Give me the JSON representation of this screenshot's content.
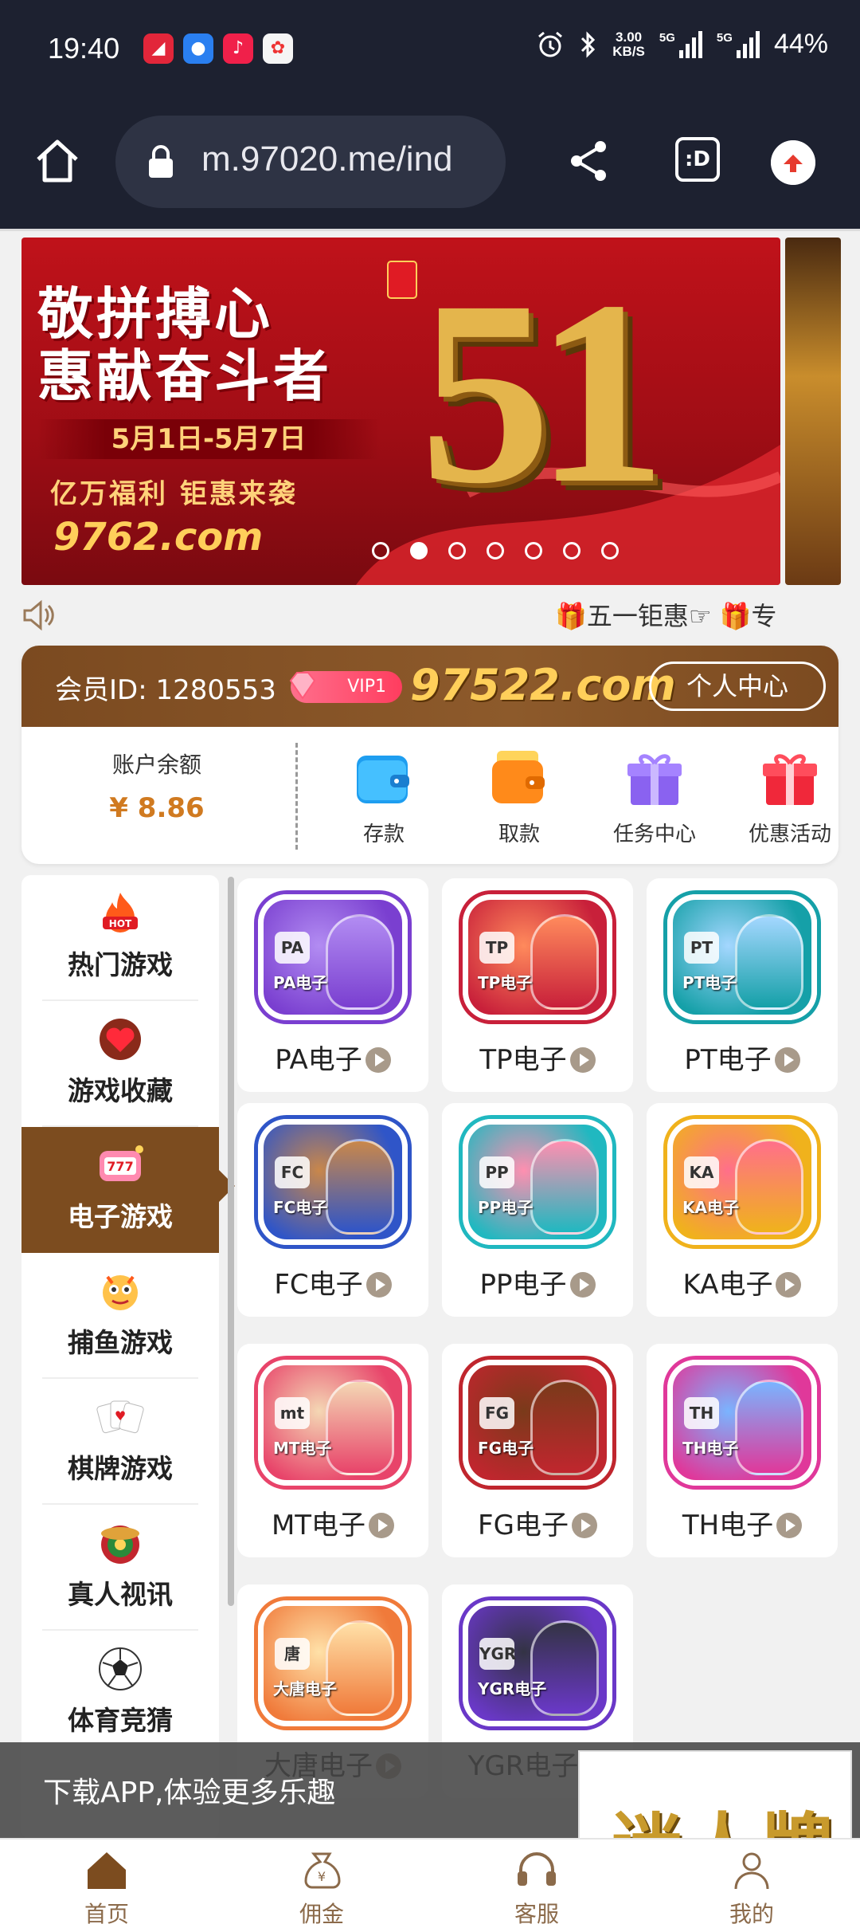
{
  "status_bar": {
    "time": "19:40",
    "net_speed": "3.00",
    "net_speed_unit": "KB/S",
    "sim1_label": "5G",
    "sim2_label": "5G",
    "battery": "44%",
    "apps": [
      "app-red-icon",
      "app-blue-icon",
      "music-icon",
      "game-icon"
    ],
    "icons": [
      "alarm-icon",
      "bluetooth-icon"
    ]
  },
  "browser": {
    "url": "m.97020.me/ind",
    "tabs_glyph": ":D"
  },
  "banner": {
    "headline_1": "敬拼搏心",
    "headline_2": "惠献奋斗者",
    "date_range": "5月1日-5月7日",
    "subtitle": "亿万福利 钜惠来袭",
    "logo_text": "9762.com",
    "big_number": "51",
    "slide_count": 7,
    "active_slide": 1
  },
  "marquee": {
    "text": "🎁五一钜惠☞   🎁专"
  },
  "member": {
    "id_label": "会员ID: 1280553",
    "vip": "VIP1",
    "logo": "97522.com",
    "center_button": "个人中心",
    "balance_label": "账户余额",
    "balance": "¥ 8.86",
    "actions": [
      {
        "label": "存款",
        "icon": "wallet-blue-icon"
      },
      {
        "label": "取款",
        "icon": "wallet-orange-icon"
      },
      {
        "label": "任务中心",
        "icon": "gift-purple-icon"
      },
      {
        "label": "优惠活动",
        "icon": "gift-red-icon"
      }
    ]
  },
  "categories": [
    {
      "label": "热门游戏",
      "icon": "hot-flame-icon"
    },
    {
      "label": "游戏收藏",
      "icon": "heart-icon"
    },
    {
      "label": "电子游戏",
      "icon": "slot-machine-icon",
      "active": true
    },
    {
      "label": "捕鱼游戏",
      "icon": "fish-icon"
    },
    {
      "label": "棋牌游戏",
      "icon": "cards-icon"
    },
    {
      "label": "真人视讯",
      "icon": "roulette-icon"
    },
    {
      "label": "体育竞猜",
      "icon": "soccer-ball-icon"
    }
  ],
  "games": [
    {
      "name": "PA电子",
      "badge": "PA电子",
      "logo": "PA",
      "color": "#7a3fd0",
      "accent": "#b28cf2"
    },
    {
      "name": "TP电子",
      "badge": "TP电子",
      "logo": "TP",
      "color": "#c8203a",
      "accent": "#ff8a5c"
    },
    {
      "name": "PT电子",
      "badge": "PT电子",
      "logo": "PT",
      "color": "#15a0a8",
      "accent": "#a4d7ff"
    },
    {
      "name": "FC电子",
      "badge": "FC电子",
      "logo": "FC",
      "color": "#2f55c8",
      "accent": "#c9874a"
    },
    {
      "name": "PP电子",
      "badge": "PP电子",
      "logo": "PP",
      "color": "#20b8c0",
      "accent": "#ff8fb0"
    },
    {
      "name": "KA电子",
      "badge": "KA电子",
      "logo": "KA",
      "color": "#f0b21c",
      "accent": "#ff6f8a"
    },
    {
      "name": "MT电子",
      "badge": "MT电子",
      "logo": "mt",
      "color": "#e8446a",
      "accent": "#f4d7b4"
    },
    {
      "name": "FG电子",
      "badge": "FG电子",
      "logo": "FG",
      "color": "#c0262e",
      "accent": "#7a3a1a"
    },
    {
      "name": "TH电子",
      "badge": "TH电子",
      "logo": "TH",
      "color": "#e0389a",
      "accent": "#7ab4ff"
    },
    {
      "name": "大唐电子",
      "badge": "大唐电子",
      "logo": "唐",
      "color": "#f07a3a",
      "accent": "#ffe1a8"
    },
    {
      "name": "YGR电子",
      "badge": "YGR电子",
      "logo": "YGR",
      "color": "#6a38c8",
      "accent": "#333344"
    }
  ],
  "download": {
    "text": "下载APP,体验更多乐趣",
    "ad_text": "迷人牌"
  },
  "bottom_nav": [
    {
      "label": "首页",
      "icon": "home-icon"
    },
    {
      "label": "佣金",
      "icon": "money-bag-icon"
    },
    {
      "label": "客服",
      "icon": "headset-icon"
    },
    {
      "label": "我的",
      "icon": "profile-icon"
    }
  ]
}
